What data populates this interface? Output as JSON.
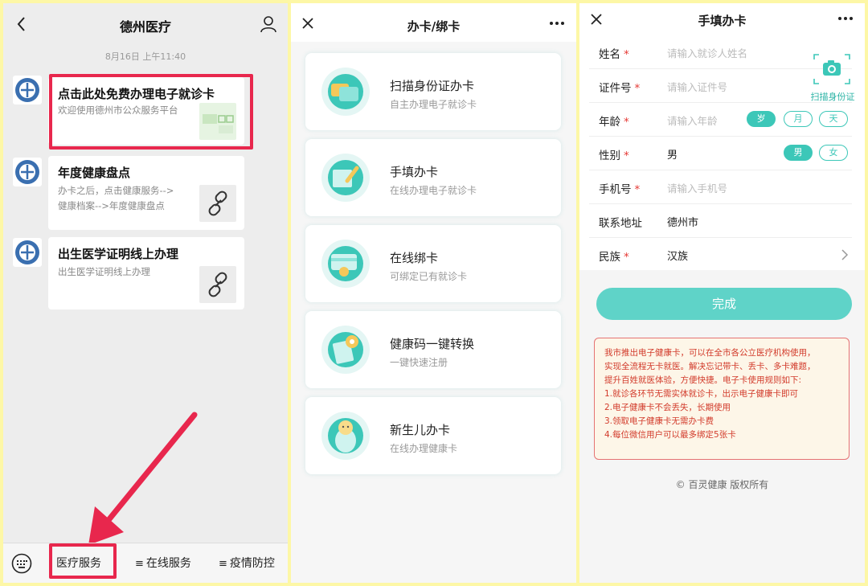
{
  "colors": {
    "accent": "#3cc7b8",
    "highlight": "#e8274d",
    "notice_text": "#d23b2b"
  },
  "panel1": {
    "title": "德州医疗",
    "timestamp": "8月16日 上午11:40",
    "messages": [
      {
        "title": "点击此处免费办理电子就诊卡",
        "desc": "欢迎使用德州市公众服务平台",
        "thumb": "card-thumbnail"
      },
      {
        "title": "年度健康盘点",
        "desc_lines": [
          "办卡之后，点击健康服务-->",
          "健康档案-->年度健康盘点"
        ],
        "thumb": "link-icon"
      },
      {
        "title": "出生医学证明线上办理",
        "desc": "出生医学证明线上办理",
        "thumb": "link-icon"
      }
    ],
    "tabs": [
      "医疗服务",
      "在线服务",
      "疫情防控"
    ],
    "tab_menu_glyph": "≡"
  },
  "panel2": {
    "title": "办卡/绑卡",
    "services": [
      {
        "name": "扫描身份证办卡",
        "desc": "自主办理电子就诊卡",
        "icon": "id-card-scan-icon"
      },
      {
        "name": "手填办卡",
        "desc": "在线办理电子就诊卡",
        "icon": "manual-form-icon"
      },
      {
        "name": "在线绑卡",
        "desc": "可绑定已有就诊卡",
        "icon": "bind-card-icon"
      },
      {
        "name": "健康码一键转换",
        "desc": "一键快速注册",
        "icon": "health-code-icon"
      },
      {
        "name": "新生儿办卡",
        "desc": "在线办理健康卡",
        "icon": "newborn-icon"
      }
    ]
  },
  "panel3": {
    "title": "手填办卡",
    "scan_label": "扫描身份证",
    "fields": {
      "name": {
        "label": "姓名",
        "placeholder": "请输入就诊人姓名"
      },
      "id": {
        "label": "证件号",
        "placeholder": "请输入证件号"
      },
      "age": {
        "label": "年龄",
        "placeholder": "请输入年龄",
        "units": [
          "岁",
          "月",
          "天"
        ],
        "selected": "岁"
      },
      "gender": {
        "label": "性别",
        "value": "男",
        "options": [
          "男",
          "女"
        ],
        "selected": "男"
      },
      "phone": {
        "label": "手机号",
        "placeholder": "请输入手机号"
      },
      "address": {
        "label": "联系地址",
        "value": "德州市"
      },
      "ethnicity": {
        "label": "民族",
        "value": "汉族"
      }
    },
    "required_mark": "*",
    "submit": "完成",
    "notice_lines": [
      "我市推出电子健康卡，可以在全市各公立医疗机构使用，",
      "实现全流程无卡就医。解决忘记带卡、丢卡、多卡难题，",
      "提升百姓就医体验，方便快捷。电子卡使用规则如下:",
      "1.就诊各环节无需实体就诊卡，出示电子健康卡即可",
      "2.电子健康卡不会丢失，长期使用",
      "3.领取电子健康卡无需办卡费",
      "4.每位微信用户可以最多绑定5张卡"
    ],
    "copyright": "© 百灵健康 版权所有"
  }
}
